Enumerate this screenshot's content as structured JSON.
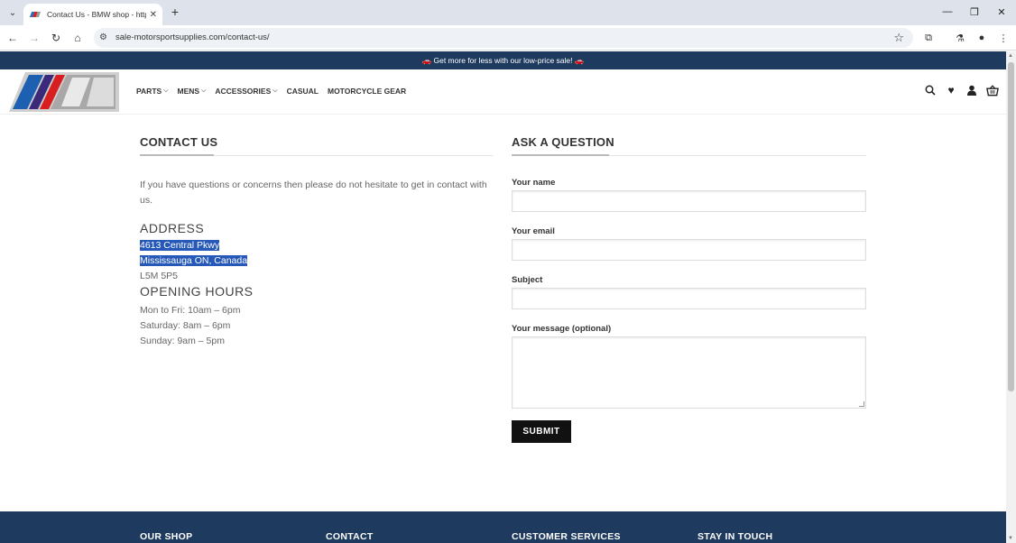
{
  "browser": {
    "tab_title": "Contact Us - BMW shop - https",
    "url": "sale-motorsportsupplies.com/contact-us/"
  },
  "promo": {
    "text": "🚗 Get more for less with our low-price sale! 🚗"
  },
  "nav": {
    "items": [
      {
        "label": "PARTS",
        "dropdown": true
      },
      {
        "label": "MENS",
        "dropdown": true
      },
      {
        "label": "ACCESSORIES",
        "dropdown": true
      },
      {
        "label": "CASUAL",
        "dropdown": false
      },
      {
        "label": "MOTORCYCLE GEAR",
        "dropdown": false
      }
    ]
  },
  "contact": {
    "title": "CONTACT US",
    "intro": "If you have questions or concerns then please do not hesitate to get in contact with us.",
    "address_heading": "ADDRESS",
    "address_line1": "4613 Central Pkwy",
    "address_line2": "Mississauga ON, Canada",
    "address_line3": "L5M 5P5",
    "hours_heading": "OPENING HOURS",
    "hours": [
      "Mon to Fri: 10am – 6pm",
      "Saturday: 8am – 6pm",
      "Sunday: 9am – 5pm"
    ]
  },
  "form": {
    "title": "ASK A QUESTION",
    "name_label": "Your name",
    "email_label": "Your email",
    "subject_label": "Subject",
    "message_label": "Your message (optional)",
    "submit_label": "SUBMIT"
  },
  "footer": {
    "col1": "OUR SHOP",
    "col2": "CONTACT",
    "col3": "CUSTOMER SERVICES",
    "col4": "STAY IN TOUCH"
  },
  "colors": {
    "brand_navy": "#1e3a5f",
    "selection": "#2558b8",
    "button": "#111111"
  }
}
